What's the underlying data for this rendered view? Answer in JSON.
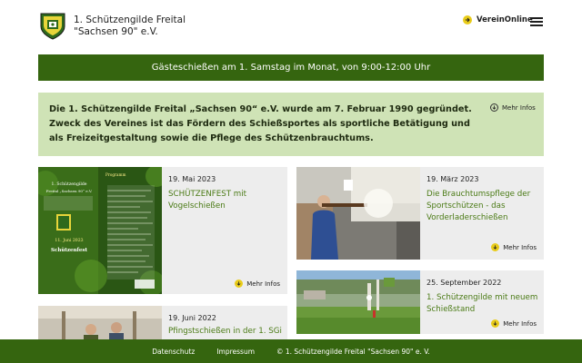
{
  "header": {
    "club_name_line1": "1. Schützengilde Freital",
    "club_name_line2": "\"Sachsen 90\" e.V.",
    "verein_online": "VereinOnline",
    "menu_icon": "hamburger-icon"
  },
  "banner": {
    "text": "Gästeschießen am 1. Samstag im Monat, von 9:00-12:00 Uhr"
  },
  "intro": {
    "text": "Die 1. Schützengilde Freital „Sachsen 90“ e.V. wurde am 7. Februar 1990 gegründet. Zweck des Vereines ist das Fördern des Schießsportes als sportliche Betätigung und als Freizeitgestaltung sowie die Pflege des Schützenbrauchtums.",
    "more_label": "Mehr Infos"
  },
  "posters": {
    "title_line1": "1. Schützengilde",
    "title_line2": "Freital „Sachsen 90“ e.V.",
    "date_line": "11. Juni 2023",
    "event_line": "Schützenfest",
    "program_heading": "Programm"
  },
  "news": [
    {
      "date": "19. Mai 2023",
      "title": "SCHÜTZENFEST mit Vogelschießen",
      "more_label": "Mehr Infos"
    },
    {
      "date": "19. März 2023",
      "title": "Die Brauchtumspflege der Sportschützen - das Vorderladerschießen",
      "more_label": "Mehr Infos"
    },
    {
      "date": "25. September 2022",
      "title": "1. Schützengilde mit neuem Schießstand",
      "more_label": "Mehr Infos"
    },
    {
      "date": "19. Juni 2022",
      "title": "Pfingstschießen in der 1. SGi"
    }
  ],
  "footer": {
    "privacy": "Datenschutz",
    "imprint": "Impressum",
    "copyright": "© 1. Schützengilde Freital \"Sachsen 90\" e. V."
  },
  "colors": {
    "brand_green": "#35650f",
    "light_green": "#cfe3b6",
    "title_green": "#4b7b16",
    "accent_yellow": "#e9cc1a",
    "card_gray": "#ededed"
  }
}
